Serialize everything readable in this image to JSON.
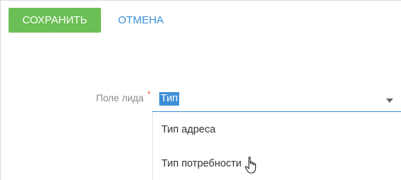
{
  "toolbar": {
    "save_label": "СОХРАНИТЬ",
    "cancel_label": "ОТМЕНА"
  },
  "form": {
    "field_label": "Поле лида",
    "required_mark": "*",
    "selected_value": "Тип"
  },
  "dropdown": {
    "options": [
      "Тип адреса",
      "Тип потребности"
    ]
  },
  "colors": {
    "save_button": "#6cbf55",
    "link": "#3c8fd6",
    "required": "#f0692b"
  },
  "icons": {
    "caret": "chevron-down-icon",
    "cursor": "hand-pointer-icon"
  }
}
